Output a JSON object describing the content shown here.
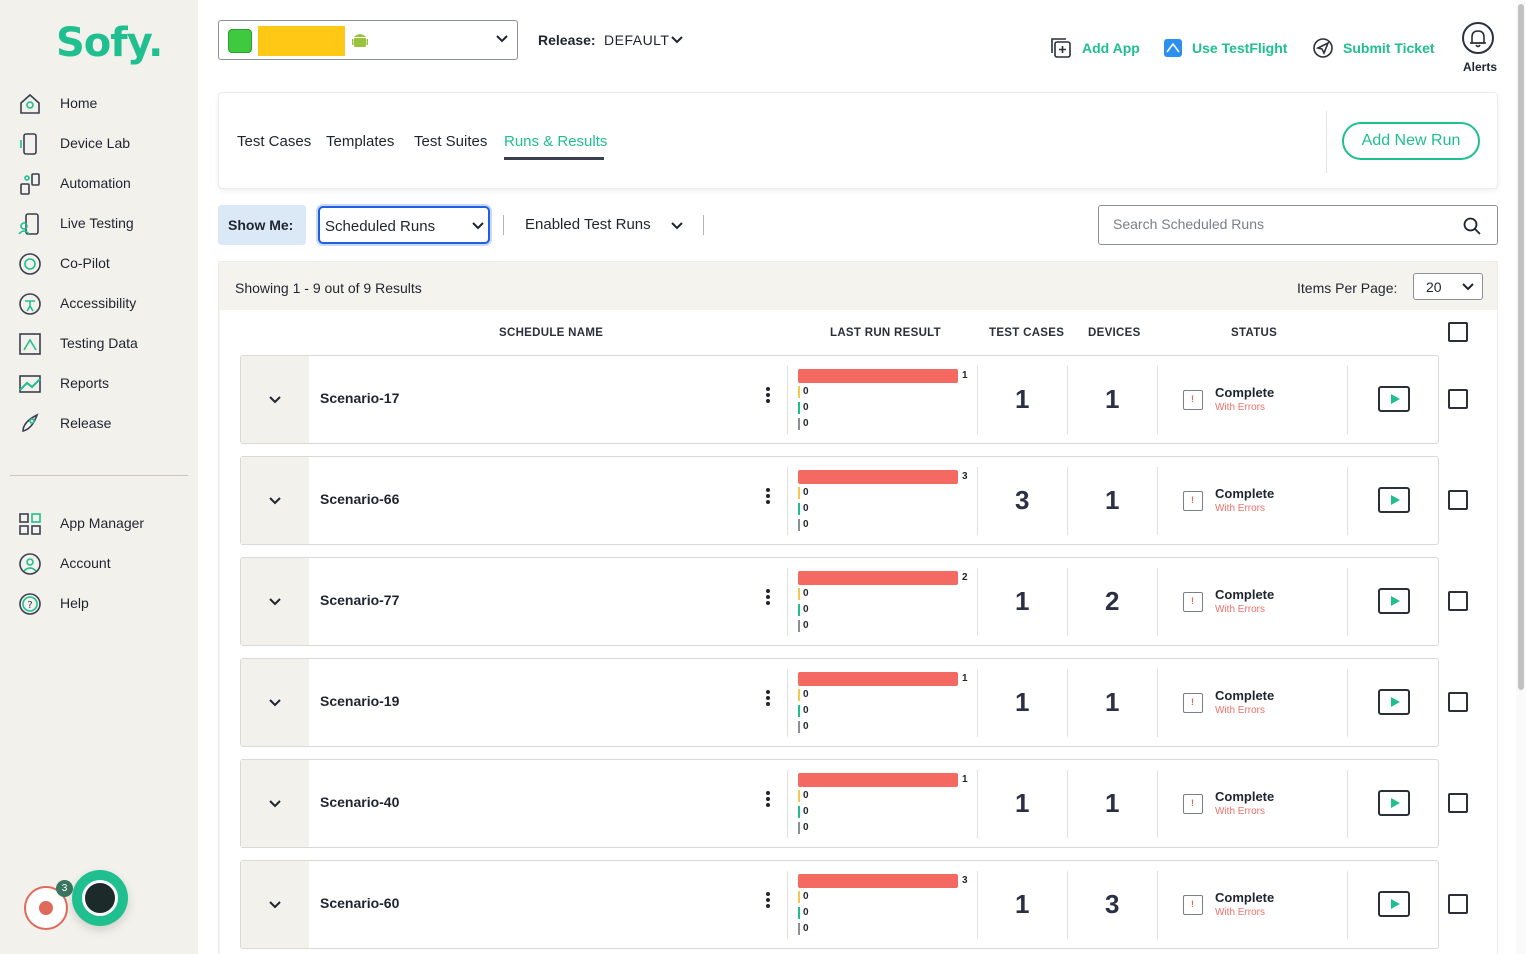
{
  "sidebar": {
    "logo": "Sofy.",
    "items": [
      {
        "label": "Home",
        "icon": "home-icon"
      },
      {
        "label": "Device Lab",
        "icon": "device-icon"
      },
      {
        "label": "Automation",
        "icon": "automation-icon"
      },
      {
        "label": "Live Testing",
        "icon": "live-testing-icon"
      },
      {
        "label": "Co-Pilot",
        "icon": "copilot-icon"
      },
      {
        "label": "Accessibility",
        "icon": "accessibility-icon"
      },
      {
        "label": "Testing Data",
        "icon": "testing-data-icon"
      },
      {
        "label": "Reports",
        "icon": "reports-icon"
      },
      {
        "label": "Release",
        "icon": "rocket-icon"
      }
    ],
    "bottom_items": [
      {
        "label": "App Manager",
        "icon": "app-manager-icon"
      },
      {
        "label": "Account",
        "icon": "account-icon"
      },
      {
        "label": "Help",
        "icon": "help-icon"
      }
    ],
    "record_badge": "3"
  },
  "topbar": {
    "release_label": "Release:",
    "release_value": "DEFAULT",
    "actions": [
      {
        "label": "Add App",
        "icon": "add-app-icon"
      },
      {
        "label": "Use TestFlight",
        "icon": "testflight-icon"
      },
      {
        "label": "Submit Ticket",
        "icon": "ticket-icon"
      }
    ],
    "alerts_label": "Alerts"
  },
  "tabs": [
    {
      "label": "Test Cases",
      "active": false
    },
    {
      "label": "Templates",
      "active": false
    },
    {
      "label": "Test Suites",
      "active": false
    },
    {
      "label": "Runs & Results",
      "active": true
    }
  ],
  "add_run_label": "Add New Run",
  "filters": {
    "show_me_label": "Show Me:",
    "show_me_value": "Scheduled Runs",
    "enabled_value": "Enabled Test Runs",
    "search_placeholder": "Search Scheduled Runs"
  },
  "results": {
    "showing_text": "Showing 1 - 9 out of 9 Results",
    "items_per_page_label": "Items Per Page:",
    "items_per_page_value": "20",
    "columns": [
      "SCHEDULE NAME",
      "LAST RUN RESULT",
      "TEST CASES",
      "DEVICES",
      "STATUS"
    ],
    "rows": [
      {
        "name": "Scenario-17",
        "failed": "1",
        "r2": "0",
        "r3": "0",
        "r4": "0",
        "test_cases": "1",
        "devices": "1",
        "status": "Complete",
        "status_sub": "With Errors"
      },
      {
        "name": "Scenario-66",
        "failed": "3",
        "r2": "0",
        "r3": "0",
        "r4": "0",
        "test_cases": "3",
        "devices": "1",
        "status": "Complete",
        "status_sub": "With Errors"
      },
      {
        "name": "Scenario-77",
        "failed": "2",
        "r2": "0",
        "r3": "0",
        "r4": "0",
        "test_cases": "1",
        "devices": "2",
        "status": "Complete",
        "status_sub": "With Errors"
      },
      {
        "name": "Scenario-19",
        "failed": "1",
        "r2": "0",
        "r3": "0",
        "r4": "0",
        "test_cases": "1",
        "devices": "1",
        "status": "Complete",
        "status_sub": "With Errors"
      },
      {
        "name": "Scenario-40",
        "failed": "1",
        "r2": "0",
        "r3": "0",
        "r4": "0",
        "test_cases": "1",
        "devices": "1",
        "status": "Complete",
        "status_sub": "With Errors"
      },
      {
        "name": "Scenario-60",
        "failed": "3",
        "r2": "0",
        "r3": "0",
        "r4": "0",
        "test_cases": "1",
        "devices": "3",
        "status": "Complete",
        "status_sub": "With Errors"
      }
    ]
  },
  "colors": {
    "accent": "#1fbf8f",
    "failed_bar": "#f46a62",
    "error_text": "#f0716a",
    "focus_blue": "#1f5fe0"
  }
}
